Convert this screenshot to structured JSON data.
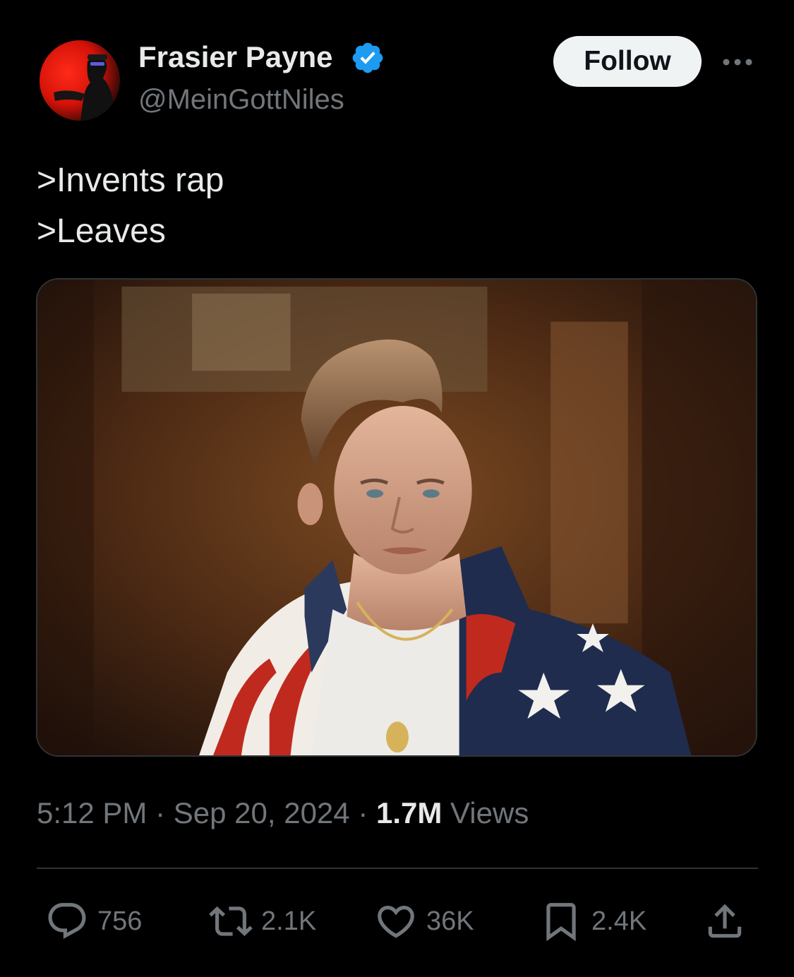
{
  "author": {
    "display_name": "Frasier Payne",
    "handle": "@MeinGottNiles",
    "verified": true,
    "verified_color": "#1d9bf0"
  },
  "header": {
    "follow_label": "Follow",
    "more_icon": "more-horizontal-icon"
  },
  "tweet": {
    "lines": [
      ">Invents rap",
      ">Leaves"
    ],
    "media_icon": "photo-of-man-in-american-flag-jacket"
  },
  "meta": {
    "time": "5:12 PM",
    "separator": "·",
    "date": "Sep 20, 2024",
    "views_count": "1.7M",
    "views_label": "Views"
  },
  "actions": {
    "replies": "756",
    "reposts": "2.1K",
    "likes": "36K",
    "bookmarks": "2.4K"
  },
  "colors": {
    "background": "#000000",
    "text_primary": "#e7e9ea",
    "text_secondary": "#71767b",
    "follow_bg": "#eff3f4",
    "divider": "#2f3336"
  }
}
